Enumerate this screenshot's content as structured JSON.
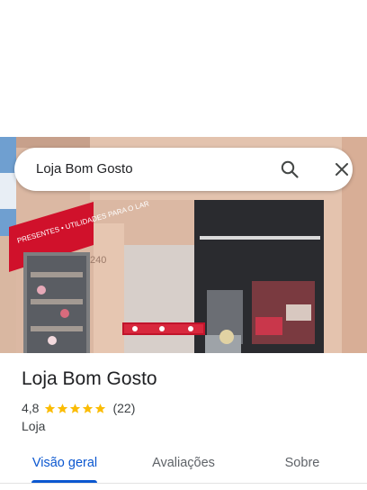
{
  "search": {
    "query": "Loja Bom Gosto",
    "search_icon": "search-icon",
    "close_icon": "close-icon"
  },
  "photo": {
    "banner_text": "PRESENTES • UTILIDADES PARA O LAR",
    "number_text": "240"
  },
  "place": {
    "title": "Loja Bom Gosto",
    "rating": "4,8",
    "stars": 5,
    "review_count": "(22)",
    "category": "Loja"
  },
  "tabs": [
    {
      "label": "Visão geral",
      "active": true
    },
    {
      "label": "Avaliações",
      "active": false
    },
    {
      "label": "Sobre",
      "active": false
    }
  ],
  "colors": {
    "accent": "#0b57d0",
    "star": "#fbbc04",
    "banner_red": "#d0112b"
  }
}
